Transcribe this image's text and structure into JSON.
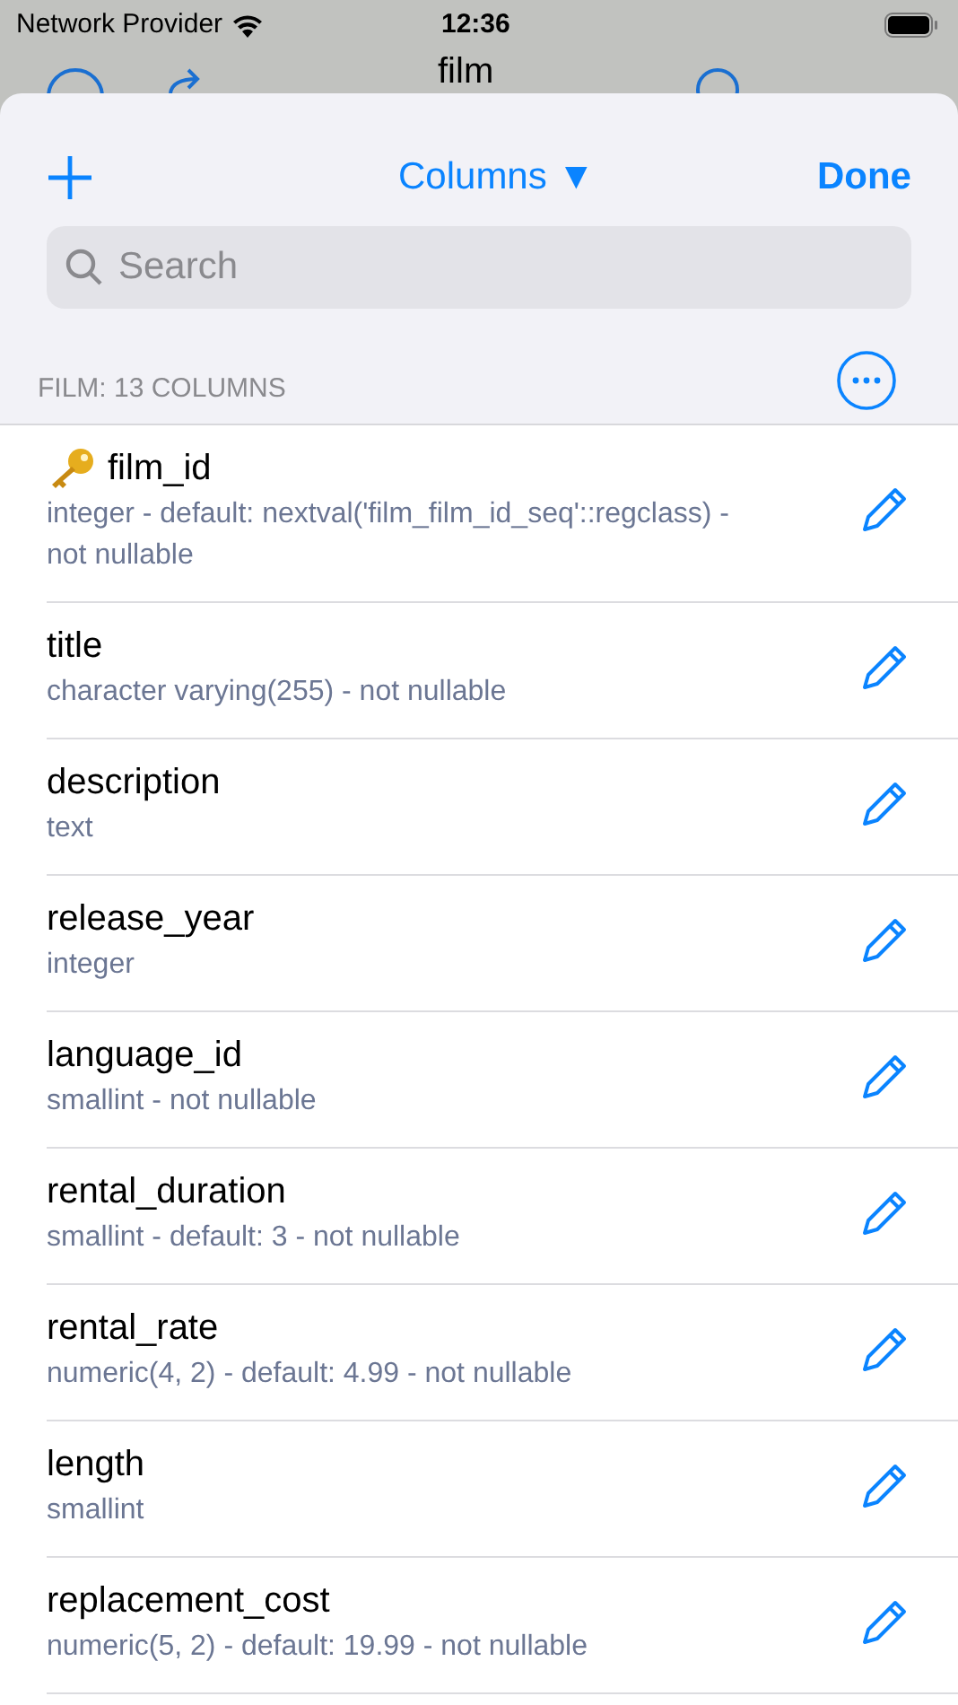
{
  "status_bar": {
    "carrier": "Network Provider",
    "time": "12:36"
  },
  "background_nav": {
    "title": "film"
  },
  "sheet": {
    "title": "Columns ▼",
    "done": "Done",
    "search": {
      "placeholder": "Search"
    },
    "section_header": "FILM: 13 COLUMNS",
    "columns": [
      {
        "name": "film_id",
        "detail": "integer - default: nextval('film_film_id_seq'::regclass) - not nullable",
        "primary_key": true
      },
      {
        "name": "title",
        "detail": "character varying(255) - not nullable",
        "primary_key": false
      },
      {
        "name": "description",
        "detail": "text",
        "primary_key": false
      },
      {
        "name": "release_year",
        "detail": "integer",
        "primary_key": false
      },
      {
        "name": "language_id",
        "detail": "smallint - not nullable",
        "primary_key": false
      },
      {
        "name": "rental_duration",
        "detail": "smallint - default: 3 - not nullable",
        "primary_key": false
      },
      {
        "name": "rental_rate",
        "detail": "numeric(4, 2) - default: 4.99 - not nullable",
        "primary_key": false
      },
      {
        "name": "length",
        "detail": "smallint",
        "primary_key": false
      },
      {
        "name": "replacement_cost",
        "detail": "numeric(5, 2) - default: 19.99 - not nullable",
        "primary_key": false
      }
    ]
  }
}
